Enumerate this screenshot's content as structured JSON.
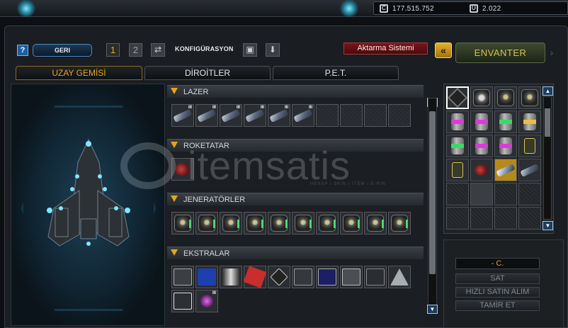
{
  "currency": {
    "credits": "177.515.752",
    "credits_icon": "C",
    "uridium": "2.022",
    "uridium_icon": "U"
  },
  "toolbar": {
    "help_label": "?",
    "back_label": "GERI",
    "config_1": "1",
    "config_2": "2",
    "config_label": "KONFIGÜRASYON",
    "transfer_label": "Aktarma Sistemi",
    "arrow_label": "«",
    "inventory_label": "ENVANTER"
  },
  "tabs": [
    {
      "label": "UZAY GEMİSİ",
      "active": true
    },
    {
      "label": "DİROİTLER",
      "active": false
    },
    {
      "label": "P.E.T.",
      "active": false
    }
  ],
  "sections": {
    "lazer": {
      "title": "LAZER",
      "filled": 6,
      "total": 10,
      "level": "III"
    },
    "roketatar": {
      "title": "ROKETATAR",
      "filled": 1,
      "total": 1
    },
    "jeneratorler": {
      "title": "JENERATÖRLER",
      "filled": 10,
      "total": 10
    },
    "ekstralar": {
      "title": "EKSTRALAR",
      "filled": 12,
      "level": "III"
    }
  },
  "inventory": {
    "price_label": "- C.",
    "sell_label": "SAT",
    "quick_buy_label": "HIZLI SATIN ALIM",
    "repair_label": "TAMİR ET"
  },
  "watermark": {
    "brand": "itemsatis",
    "tagline": "HESAP / SKIN / ITEM / E-PIN"
  },
  "colors": {
    "accent": "#e8a419",
    "transfer": "#7a1518",
    "envanter": "#d8c24a",
    "uridium": "#5a8fd0"
  }
}
